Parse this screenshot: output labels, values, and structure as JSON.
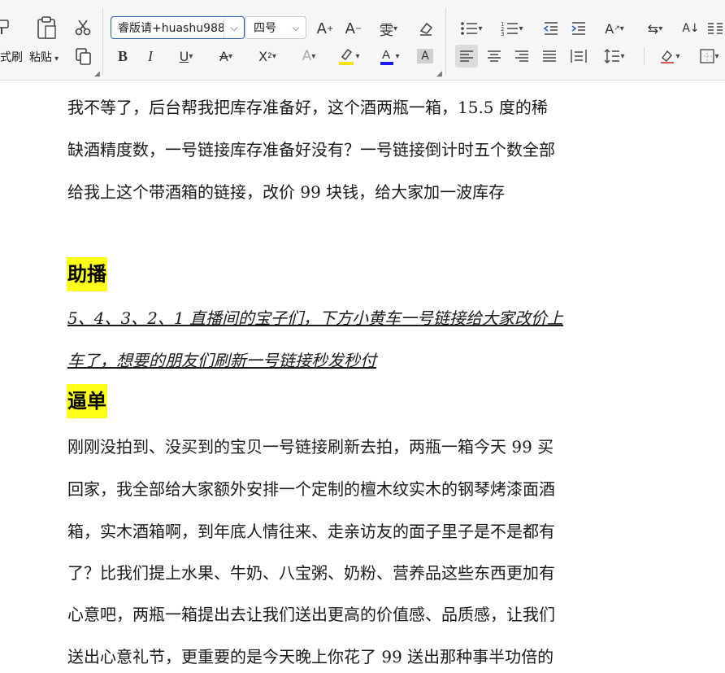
{
  "toolbar": {
    "format_painter_label": "式刷",
    "paste_label": "粘贴",
    "font_name": "睿版请+huashu988",
    "font_size": "四号",
    "icons": [
      "format-painter-icon",
      "paste-icon",
      "cut-icon",
      "copy-icon",
      "grow-font-icon",
      "shrink-font-icon",
      "phonetic-guide-icon",
      "clear-format-icon",
      "bold-icon",
      "italic-icon",
      "underline-icon",
      "strikethrough-icon",
      "superscript-icon",
      "text-effect-icon",
      "highlight-icon",
      "font-color-icon",
      "char-shading-icon",
      "bullets-icon",
      "numbering-icon",
      "decrease-indent-icon",
      "increase-indent-icon",
      "text-direction-icon",
      "chinese-layout-icon",
      "sort-icon",
      "columns-icon",
      "align-left-icon",
      "align-center-icon",
      "align-right-icon",
      "justify-icon",
      "distributed-icon",
      "line-spacing-icon",
      "shading-icon",
      "borders-icon"
    ],
    "colors": {
      "highlight": "#f5e21a",
      "font_color": "#1a1aff",
      "accent": "#2b5eb6"
    }
  },
  "document": {
    "para1": [
      "我不等了，后台帮我把库存准备好，这个酒两瓶一箱，15.5 度的稀",
      "缺酒精度数，一号链接库存准备好没有？一号链接倒计时五个数全部",
      "给我上这个带酒箱的链接，改价 99 块钱，给大家加一波库存"
    ],
    "heading1": "助播",
    "para2": [
      "5、4、3、2、1 直播间的宝子们，下方小黄车一号链接给大家改价上",
      "车了，想要的朋友们刷新一号链接秒发秒付"
    ],
    "heading2": "逼单",
    "para3": [
      "刚刚没拍到、没买到的宝贝一号链接刷新去拍，两瓶一箱今天 99 买",
      "回家，我全部给大家额外安排一个定制的檀木纹实木的钢琴烤漆面酒",
      "箱，实木酒箱啊，到年底人情往来、走亲访友的面子里子是不是都有",
      "了？比我们提上水果、牛奶、八宝粥、奶粉、营养品这些东西更加有",
      "心意吧，两瓶一箱提出去让我们送出更高的价值感、品质感，让我们",
      "送出心意礼节，更重要的是今天晚上你花了 99 送出那种事半功倍的"
    ]
  }
}
